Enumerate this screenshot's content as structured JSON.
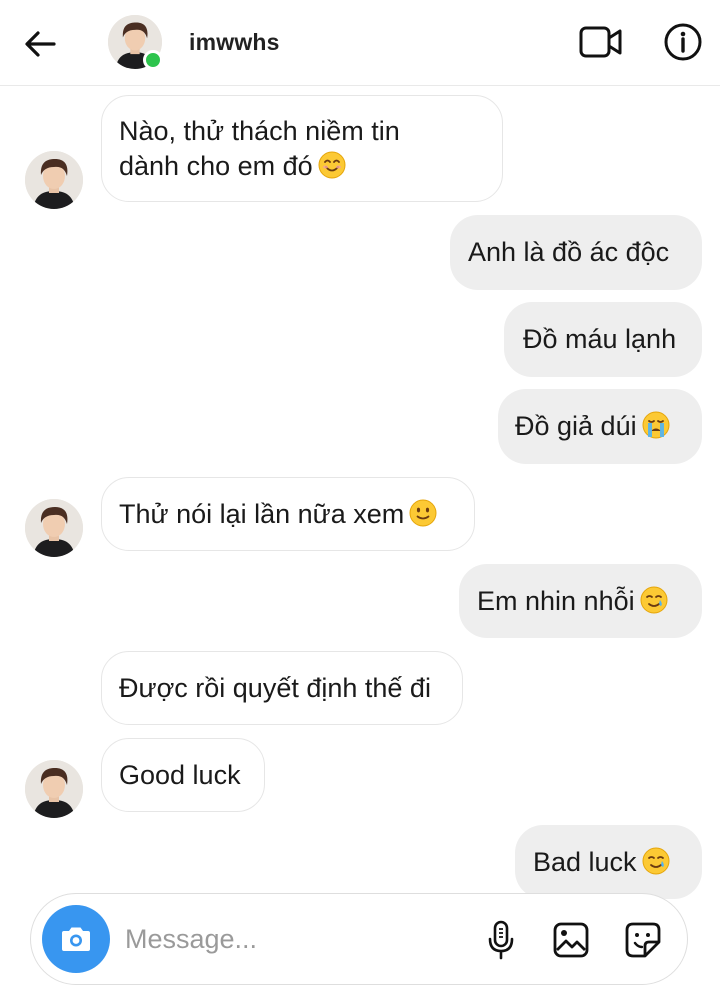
{
  "header": {
    "username": "imwwhs",
    "online": true
  },
  "messages": [
    {
      "side": "in",
      "lines": [
        "Nào, thử thách niềm tin",
        "dành cho em đó"
      ],
      "emoji": "smiling-face-icon"
    },
    {
      "side": "out",
      "text": "Anh là đồ ác độc"
    },
    {
      "side": "out",
      "text": "Đồ máu lạnh"
    },
    {
      "side": "out",
      "text": "Đồ giả dúi",
      "emoji": "loudly-crying-face-icon"
    },
    {
      "side": "in",
      "text": "Thử nói lại lần nữa xem",
      "emoji": "slightly-smiling-face-icon"
    },
    {
      "side": "out",
      "text": "Em nhin nhỗi",
      "emoji": "smiling-face-with-tear-icon"
    },
    {
      "side": "in",
      "text": "Được rồi quyết định thế đi"
    },
    {
      "side": "in",
      "text": "Good luck"
    },
    {
      "side": "out",
      "text": "Bad luck",
      "emoji": "smiling-face-with-tear-icon"
    }
  ],
  "composer": {
    "placeholder": "Message..."
  },
  "colors": {
    "accent": "#3896f0",
    "online": "#2dc44d",
    "outgoing_bubble": "#eeeeee",
    "incoming_border": "#e6e6e6"
  }
}
